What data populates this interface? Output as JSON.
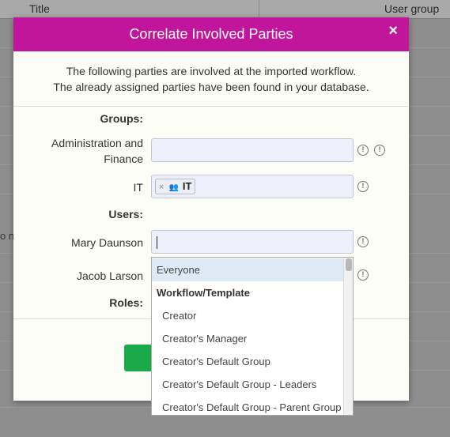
{
  "background": {
    "columns": {
      "title": "Title",
      "user_group": "User group"
    },
    "truncated_text": "o n"
  },
  "modal": {
    "title": "Correlate Involved Parties",
    "close_icon": "×",
    "intro_lines": [
      "The following parties are involved at the imported workflow.",
      "The already assigned parties have been found in your database."
    ],
    "groups_heading": "Groups:",
    "users_heading": "Users:",
    "roles_heading": "Roles:",
    "groups": [
      {
        "label_lines": [
          "Administration and",
          "Finance"
        ],
        "value": ""
      },
      {
        "label_lines": [
          "IT"
        ],
        "tag": "IT"
      }
    ],
    "users": [
      {
        "label": "Mary Daunson",
        "value": ""
      },
      {
        "label": "Jacob Larson",
        "value": ""
      }
    ],
    "info_icon": "!",
    "tag_remove": "×",
    "tag_group_icon": "👥"
  },
  "dropdown": {
    "options": [
      {
        "label": "Everyone",
        "kind": "option",
        "selected": true
      },
      {
        "label": "Workflow/Template",
        "kind": "group"
      },
      {
        "label": "Creator",
        "kind": "option"
      },
      {
        "label": "Creator's Manager",
        "kind": "option"
      },
      {
        "label": "Creator's Default Group",
        "kind": "option"
      },
      {
        "label": "Creator's Default Group - Leaders",
        "kind": "option"
      },
      {
        "label": "Creator's Default Group - Parent Group",
        "kind": "option"
      }
    ]
  },
  "colors": {
    "header": "#c1169c",
    "ok_button": "#1aaa4a",
    "input_bg": "#eef0fb",
    "selected_option": "#ddeaf5"
  }
}
